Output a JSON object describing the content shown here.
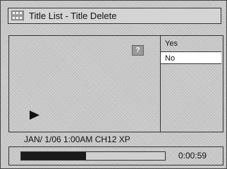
{
  "window": {
    "title": "Title List - Title Delete"
  },
  "icons": {
    "title": "film-strip-icon",
    "info": "info-icon",
    "play": "play-icon"
  },
  "preview": {
    "info_glyph": "?"
  },
  "menu": {
    "options": [
      "Yes",
      "No"
    ],
    "selected": "No"
  },
  "status": {
    "text": "JAN/ 1/06 1:00AM CH12 XP"
  },
  "progress": {
    "fraction": 0.45,
    "time": "0:00:59"
  }
}
